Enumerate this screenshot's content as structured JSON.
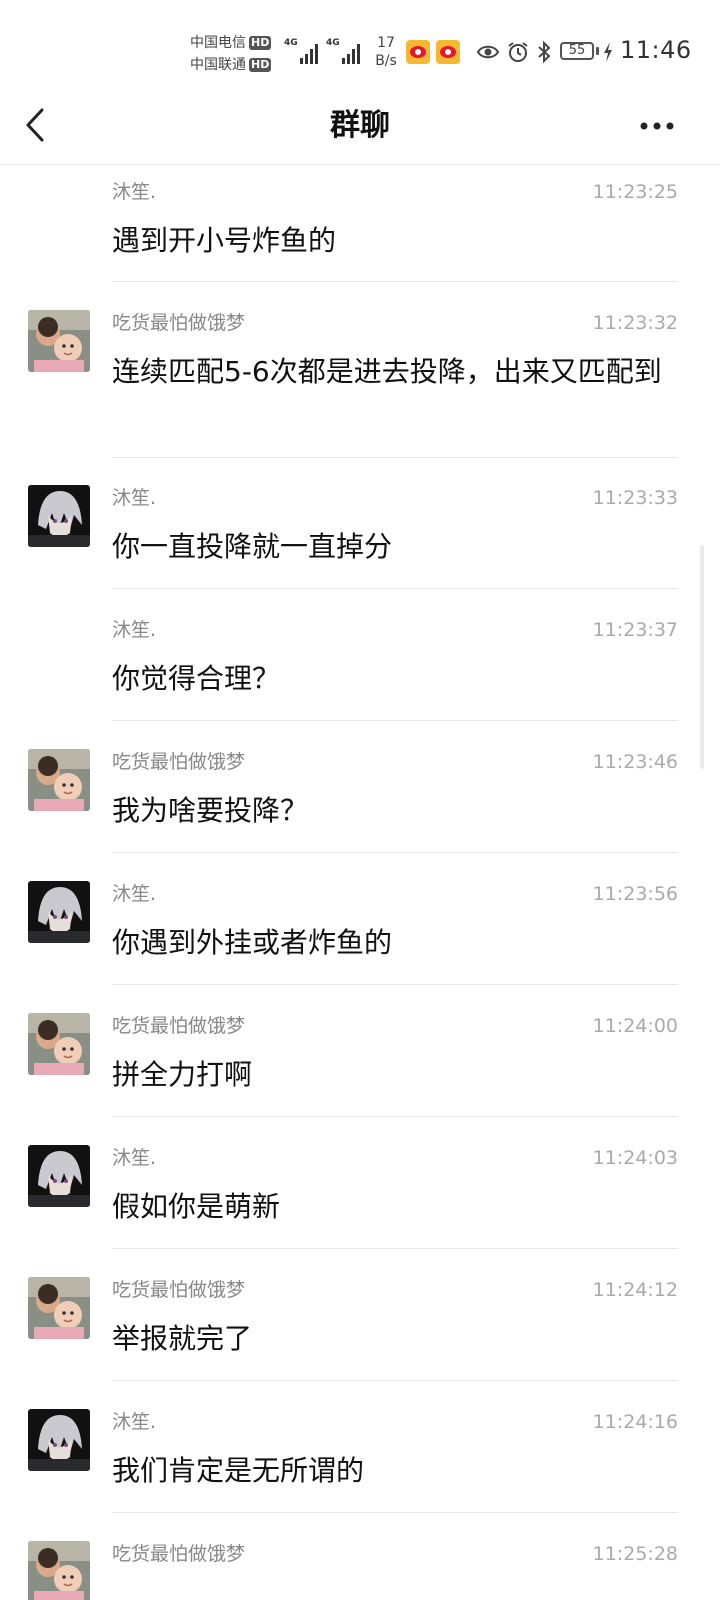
{
  "status_bar": {
    "carrier_1": "中国电信",
    "carrier_2": "中国联通",
    "hd_label": "HD",
    "network_1": "4G",
    "network_2": "4G",
    "net_speed_value": "17",
    "net_speed_unit": "B/s",
    "battery_level": "55",
    "time": "11:46"
  },
  "nav": {
    "title": "群聊"
  },
  "messages": [
    {
      "sender": "沐笙.",
      "time": "11:23:25",
      "text": "遇到开小号炸鱼的",
      "avatar": "none"
    },
    {
      "sender": "吃货最怕做饿梦",
      "time": "11:23:32",
      "text": "连续匹配5-6次都是进去投降，出来又匹配到",
      "avatar": "kids-photo"
    },
    {
      "sender": "沐笙.",
      "time": "11:23:33",
      "text": "你一直投降就一直掉分",
      "avatar": "anime-character"
    },
    {
      "sender": "沐笙.",
      "time": "11:23:37",
      "text": "你觉得合理？",
      "avatar": "none"
    },
    {
      "sender": "吃货最怕做饿梦",
      "time": "11:23:46",
      "text": "我为啥要投降？",
      "avatar": "kids-photo"
    },
    {
      "sender": "沐笙.",
      "time": "11:23:56",
      "text": "你遇到外挂或者炸鱼的",
      "avatar": "anime-character"
    },
    {
      "sender": "吃货最怕做饿梦",
      "time": "11:24:00",
      "text": "拼全力打啊",
      "avatar": "kids-photo"
    },
    {
      "sender": "沐笙.",
      "time": "11:24:03",
      "text": "假如你是萌新",
      "avatar": "anime-character"
    },
    {
      "sender": "吃货最怕做饿梦",
      "time": "11:24:12",
      "text": "举报就完了",
      "avatar": "kids-photo"
    },
    {
      "sender": "沐笙.",
      "time": "11:24:16",
      "text": "我们肯定是无所谓的",
      "avatar": "anime-character"
    },
    {
      "sender": "吃货最怕做饿梦",
      "time": "11:25:28",
      "text": "",
      "avatar": "kids-photo"
    }
  ]
}
